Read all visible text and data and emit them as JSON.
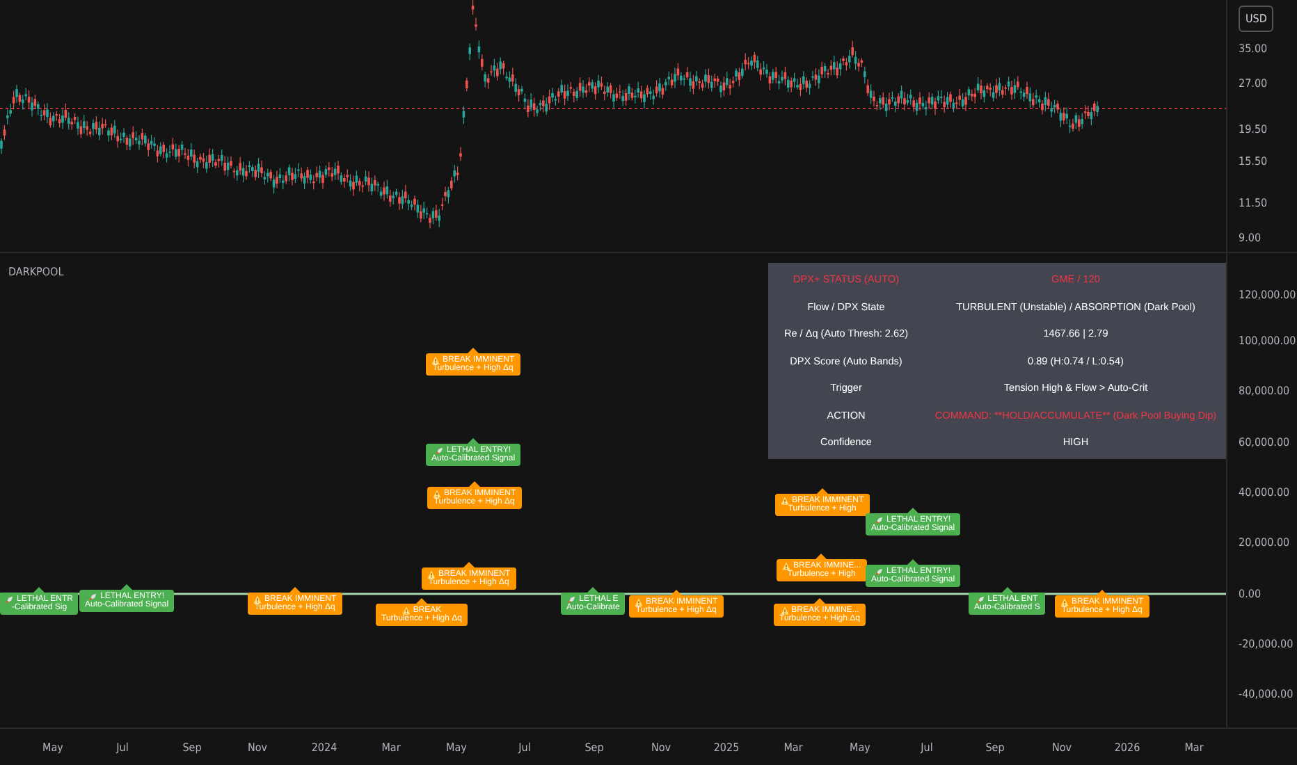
{
  "price_pane": {
    "currency": "USD",
    "axis_ticks": [
      "35.00",
      "27.00",
      "19.50",
      "15.50",
      "11.50",
      "9.00"
    ]
  },
  "indicator_pane": {
    "title": "DARKPOOL",
    "axis_ticks": [
      "120,000.00",
      "100,000.00",
      "80,000.00",
      "60,000.00",
      "40,000.00",
      "20,000.00",
      "0.00",
      "-20,000.00",
      "-40,000.00"
    ],
    "status_table": {
      "header": {
        "label": "DPX+ STATUS (AUTO)",
        "value": "GME / 120"
      },
      "rows": [
        {
          "label": "Flow / DPX State",
          "value": "TURBULENT (Unstable) / ABSORPTION (Dark Pool)",
          "alert": false
        },
        {
          "label": "Re / Δq (Auto Thresh: 2.62)",
          "value": "1467.66  |  2.79",
          "alert": false
        },
        {
          "label": "DPX Score (Auto Bands)",
          "value": "0.89 (H:0.74 / L:0.54)",
          "alert": false
        },
        {
          "label": "Trigger",
          "value": "Tension High & Flow > Auto-Crit",
          "alert": false
        },
        {
          "label": "ACTION",
          "value": "COMMAND: **HOLD/ACCUMULATE** (Dark Pool Buying Dip)",
          "alert": true
        },
        {
          "label": "Confidence",
          "value": "HIGH",
          "alert": false
        }
      ]
    },
    "signals": [
      {
        "kind": "break",
        "title": "BREAK IMMINENT",
        "subtitle": "Turbulence + High Δq"
      },
      {
        "kind": "lethal",
        "title": "LETHAL ENTRY!",
        "subtitle": "Auto-Calibrated Signal"
      },
      {
        "kind": "break",
        "title": "BREAK IMMINENT",
        "subtitle": "Turbulence + High Δq"
      },
      {
        "kind": "break",
        "title": "BREAK IMMINENT",
        "subtitle": "Turbulence + High"
      },
      {
        "kind": "lethal",
        "title": "LETHAL ENTRY!",
        "subtitle": "Auto-Calibrated Signal"
      },
      {
        "kind": "break",
        "title": "BREAK IMMINENT",
        "subtitle": "Turbulence + High Δq"
      },
      {
        "kind": "break",
        "title": "BREAK IMMINE...",
        "subtitle": "Turbulence + High"
      },
      {
        "kind": "lethal",
        "title": "LETHAL ENTRY!",
        "subtitle": "Auto-Calibrated Signal"
      },
      {
        "kind": "lethal",
        "title": "LETHAL ENTR",
        "subtitle": "-Calibrated Sig"
      },
      {
        "kind": "lethal",
        "title": "LETHAL ENTRY!",
        "subtitle": "Auto-Calibrated Signal"
      },
      {
        "kind": "break",
        "title": "BREAK IMMINENT",
        "subtitle": "Turbulence + High Δq"
      },
      {
        "kind": "lethal",
        "title": "LETHAL E",
        "subtitle": "Auto-Calibrate"
      },
      {
        "kind": "break",
        "title": "BREAK IMMINENT",
        "subtitle": "Turbulence + High Δq"
      },
      {
        "kind": "lethal",
        "title": "LETHAL ENT",
        "subtitle": "Auto-Calibrated S"
      },
      {
        "kind": "break",
        "title": "BREAK IMMINENT",
        "subtitle": "Turbulence + High Δq"
      },
      {
        "kind": "break",
        "title": "BREAK",
        "subtitle": "Turbulence + High Δq"
      },
      {
        "kind": "break",
        "title": "BREAK IMMINE...",
        "subtitle": "Turbulence + High Δq"
      }
    ]
  },
  "time_axis": [
    "May",
    "Jul",
    "Sep",
    "Nov",
    "2024",
    "Mar",
    "May",
    "Jul",
    "Sep",
    "Nov",
    "2025",
    "Mar",
    "May",
    "Jul",
    "Sep",
    "Nov",
    "2026",
    "Mar"
  ]
}
